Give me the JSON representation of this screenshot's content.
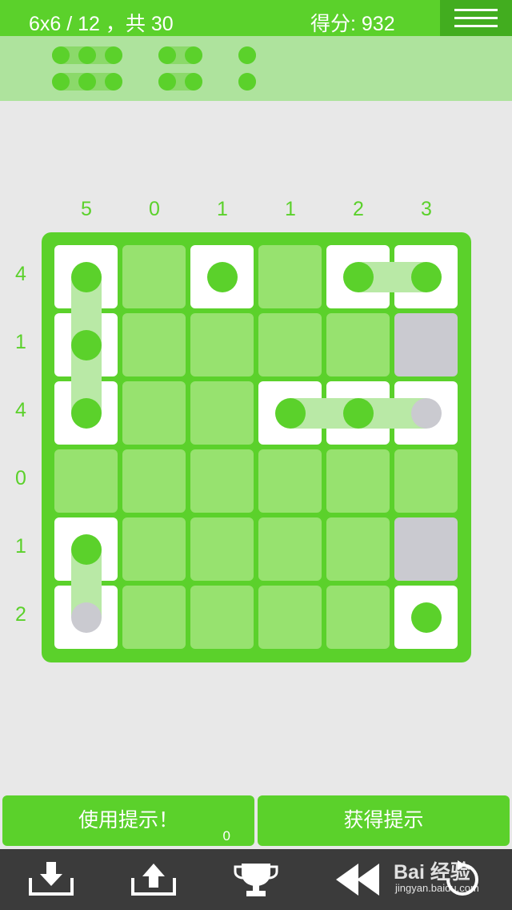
{
  "header": {
    "level": "6x6 / 12 ，共 30",
    "score": "得分: 932"
  },
  "legend": {
    "ships": [
      3,
      3,
      2,
      2,
      1,
      1
    ]
  },
  "board": {
    "size": 6,
    "column_clues": [
      "5",
      "0",
      "1",
      "1",
      "2",
      "3"
    ],
    "row_clues": [
      "4",
      "1",
      "4",
      "0",
      "1",
      "2"
    ],
    "grid": [
      [
        "ship",
        "empty",
        "ship",
        "empty",
        "ship",
        "ship"
      ],
      [
        "ship",
        "empty",
        "empty",
        "empty",
        "empty",
        "water"
      ],
      [
        "ship",
        "empty",
        "empty",
        "ship",
        "ship",
        "ship-gray"
      ],
      [
        "empty",
        "empty",
        "empty",
        "empty",
        "empty",
        "empty"
      ],
      [
        "ship",
        "empty",
        "empty",
        "empty",
        "empty",
        "water"
      ],
      [
        "ship-gray",
        "empty",
        "empty",
        "empty",
        "empty",
        "ship"
      ]
    ],
    "links": [
      {
        "from": [
          0,
          0
        ],
        "to": [
          2,
          0
        ]
      },
      {
        "from": [
          0,
          4
        ],
        "to": [
          0,
          5
        ]
      },
      {
        "from": [
          2,
          3
        ],
        "to": [
          2,
          5
        ]
      },
      {
        "from": [
          4,
          0
        ],
        "to": [
          5,
          0
        ]
      }
    ]
  },
  "buttons": {
    "use_hint": "使用提示！",
    "hint_count": "0",
    "get_hint": "获得提示"
  },
  "toolbar": {
    "icons": [
      "download-icon",
      "upload-icon",
      "trophy-icon",
      "rewind-icon",
      "restart-icon"
    ]
  },
  "watermark": {
    "brand": "Bai 经验",
    "url": "jingyan.baidu.com"
  },
  "colors": {
    "accent": "#5bd12b",
    "accent_dark": "#42ad1f",
    "cell": "#97e26f",
    "water": "#cacad0",
    "toolbar": "#3b3b3b"
  }
}
